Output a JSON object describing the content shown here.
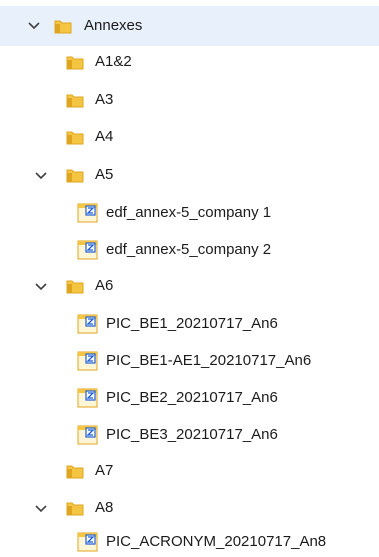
{
  "tree": {
    "root": {
      "label": "Annexes",
      "expanded": true,
      "icon": "folder-icon"
    },
    "items": [
      {
        "label": "A1&2",
        "kind": "folder",
        "expanded": false,
        "icon": "folder-icon"
      },
      {
        "label": "A3",
        "kind": "folder",
        "expanded": false,
        "icon": "folder-icon"
      },
      {
        "label": "A4",
        "kind": "folder",
        "expanded": false,
        "icon": "folder-icon"
      },
      {
        "label": "A5",
        "kind": "folder",
        "expanded": true,
        "icon": "folder-icon"
      },
      {
        "label": "edf_annex-5_company 1",
        "kind": "file",
        "icon": "document-icon"
      },
      {
        "label": "edf_annex-5_company 2",
        "kind": "file",
        "icon": "document-icon"
      },
      {
        "label": "A6",
        "kind": "folder",
        "expanded": true,
        "icon": "folder-icon"
      },
      {
        "label": "PIC_BE1_20210717_An6",
        "kind": "file",
        "icon": "document-icon"
      },
      {
        "label": "PIC_BE1-AE1_20210717_An6",
        "kind": "file",
        "icon": "document-icon"
      },
      {
        "label": "PIC_BE2_20210717_An6",
        "kind": "file",
        "icon": "document-icon"
      },
      {
        "label": "PIC_BE3_20210717_An6",
        "kind": "file",
        "icon": "document-icon"
      },
      {
        "label": "A7",
        "kind": "folder",
        "expanded": false,
        "icon": "folder-icon"
      },
      {
        "label": "A8",
        "kind": "folder",
        "expanded": true,
        "icon": "folder-icon"
      },
      {
        "label": "PIC_ACRONYM_20210717_An8",
        "kind": "file",
        "icon": "document-icon"
      }
    ]
  },
  "colors": {
    "selection": "#e8f1fb",
    "folder": "#f4c542",
    "folder_dark": "#e0a520",
    "text": "#1b1b1b",
    "chevron": "#404040",
    "doc_blue": "#1f5fd6"
  }
}
